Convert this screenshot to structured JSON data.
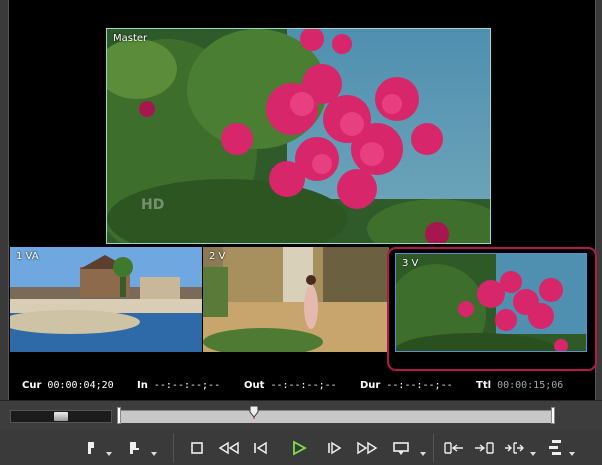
{
  "views": {
    "master_label": "Master",
    "master_watermark": "HD",
    "sub1_label": "1 VA",
    "sub2_label": "2 V",
    "sub3_label": "3 V"
  },
  "timecodes": {
    "cur_label": "Cur",
    "cur_value": "00:00:04;20",
    "in_label": "In",
    "in_value": "--:--:--;--",
    "out_label": "Out",
    "out_value": "--:--:--;--",
    "dur_label": "Dur",
    "dur_value": "--:--:--;--",
    "ttl_label": "Ttl",
    "ttl_value": "00:00:15;06"
  },
  "scrub": {
    "playhead_fraction": 0.31,
    "jog_position": 0.5
  },
  "toolbar": {
    "buttons": [
      "set-in-icon",
      "set-out-icon",
      "stop-icon",
      "rewind-icon",
      "step-back-icon",
      "play-icon",
      "step-forward-icon",
      "fast-forward-icon",
      "loop-icon",
      "insert-icon",
      "overwrite-icon",
      "replace-icon",
      "settings-icon"
    ]
  },
  "colors": {
    "selection_ring": "#b31a48",
    "play_icon": "#7be04a",
    "master_border": "#9ed5c8",
    "sub3_border": "#5a8fd0"
  }
}
